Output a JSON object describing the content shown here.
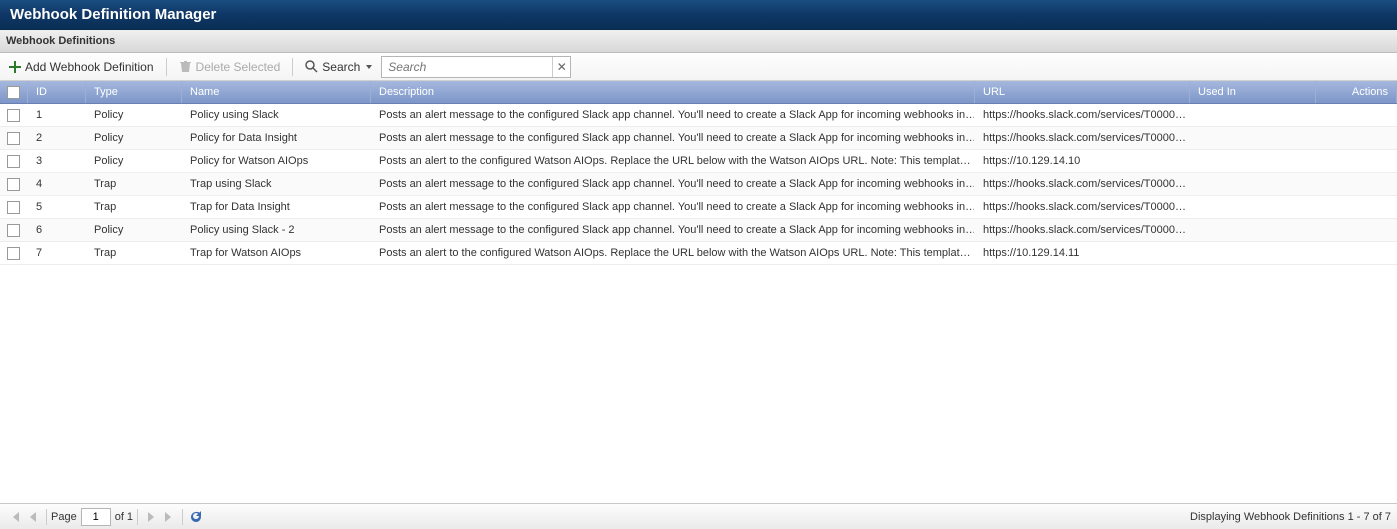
{
  "title": "Webhook Definition Manager",
  "subtitle": "Webhook Definitions",
  "toolbar": {
    "add_label": "Add Webhook Definition",
    "delete_label": "Delete Selected",
    "search_label": "Search",
    "search_placeholder": "Search"
  },
  "columns": {
    "id": "ID",
    "type": "Type",
    "name": "Name",
    "description": "Description",
    "url": "URL",
    "used_in": "Used In",
    "actions": "Actions"
  },
  "rows": [
    {
      "id": "1",
      "type": "Policy",
      "name": "Policy using Slack",
      "description": "Posts an alert message to the configured Slack app channel. You'll need to create a Slack App for incoming webhooks in…",
      "url": "https://hooks.slack.com/services/T0000…",
      "used_in": ""
    },
    {
      "id": "2",
      "type": "Policy",
      "name": "Policy for Data Insight",
      "description": "Posts an alert message to the configured Slack app channel. You'll need to create a Slack App for incoming webhooks in…",
      "url": "https://hooks.slack.com/services/T0000…",
      "used_in": ""
    },
    {
      "id": "3",
      "type": "Policy",
      "name": "Policy for Watson AIOps",
      "description": "Posts an alert to the configured Watson AIOps. Replace the URL below with the Watson AIOps URL. Note: This templat…",
      "url": "https://10.129.14.10",
      "used_in": ""
    },
    {
      "id": "4",
      "type": "Trap",
      "name": "Trap using Slack",
      "description": "Posts an alert message to the configured Slack app channel. You'll need to create a Slack App for incoming webhooks in…",
      "url": "https://hooks.slack.com/services/T0000…",
      "used_in": ""
    },
    {
      "id": "5",
      "type": "Trap",
      "name": "Trap for Data Insight",
      "description": "Posts an alert message to the configured Slack app channel. You'll need to create a Slack App for incoming webhooks in…",
      "url": "https://hooks.slack.com/services/T0000…",
      "used_in": ""
    },
    {
      "id": "6",
      "type": "Policy",
      "name": "Policy using Slack - 2",
      "description": "Posts an alert message to the configured Slack app channel. You'll need to create a Slack App for incoming webhooks in…",
      "url": "https://hooks.slack.com/services/T0000…",
      "used_in": ""
    },
    {
      "id": "7",
      "type": "Trap",
      "name": "Trap for Watson AIOps",
      "description": "Posts an alert to the configured Watson AIOps. Replace the URL below with the Watson AIOps URL. Note: This templat…",
      "url": "https://10.129.14.11",
      "used_in": ""
    }
  ],
  "paging": {
    "page_label": "Page",
    "of_label": "of 1",
    "current": "1",
    "display_text": "Displaying Webhook Definitions 1 - 7 of 7"
  }
}
